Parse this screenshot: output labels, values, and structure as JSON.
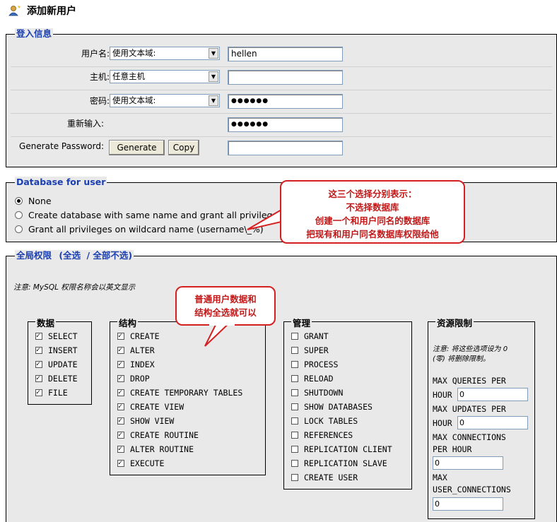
{
  "page": {
    "title": "添加新用户"
  },
  "login": {
    "legend": "登入信息",
    "username": {
      "label": "用户名:",
      "mode": "使用文本域:",
      "value": "hellen"
    },
    "host": {
      "label": "主机:",
      "mode": "任意主机",
      "value": ""
    },
    "password": {
      "label": "密码:",
      "mode": "使用文本域:",
      "value": "●●●●●●"
    },
    "retype": {
      "label": "重新输入:",
      "value": "●●●●●●"
    },
    "generate": {
      "label": "Generate Password:",
      "generate_btn": "Generate",
      "copy_btn": "Copy",
      "value": ""
    }
  },
  "database": {
    "legend": "Database for user",
    "options": [
      {
        "label": "None",
        "selected": true
      },
      {
        "label": "Create database with same name and grant all privileges",
        "selected": false
      },
      {
        "label": "Grant all privileges on wildcard name (username\\_%)",
        "selected": false
      }
    ],
    "callout": [
      "这三个选择分别表示：",
      "不选择数据库",
      "创建一个和用户同名的数据库",
      "把现有和用户同名数据库权限给他"
    ]
  },
  "global": {
    "legend": "全局权限",
    "select_all": "(全选",
    "separator": "/",
    "deselect_all": "全部不选)",
    "note": "注意: MySQL 权限名称会以英文显示",
    "callout": [
      "普通用户数据和",
      "结构全选就可以"
    ],
    "data_group": {
      "legend": "数据",
      "items": [
        {
          "label": "SELECT",
          "checked": true
        },
        {
          "label": "INSERT",
          "checked": true
        },
        {
          "label": "UPDATE",
          "checked": true
        },
        {
          "label": "DELETE",
          "checked": true
        },
        {
          "label": "FILE",
          "checked": true
        }
      ]
    },
    "structure_group": {
      "legend": "结构",
      "items": [
        {
          "label": "CREATE",
          "checked": true
        },
        {
          "label": "ALTER",
          "checked": true
        },
        {
          "label": "INDEX",
          "checked": true
        },
        {
          "label": "DROP",
          "checked": true
        },
        {
          "label": "CREATE TEMPORARY TABLES",
          "checked": true
        },
        {
          "label": "CREATE VIEW",
          "checked": true
        },
        {
          "label": "SHOW VIEW",
          "checked": true
        },
        {
          "label": "CREATE ROUTINE",
          "checked": true
        },
        {
          "label": "ALTER ROUTINE",
          "checked": true
        },
        {
          "label": "EXECUTE",
          "checked": true
        }
      ]
    },
    "admin_group": {
      "legend": "管理",
      "items": [
        {
          "label": "GRANT",
          "checked": false
        },
        {
          "label": "SUPER",
          "checked": false
        },
        {
          "label": "PROCESS",
          "checked": false
        },
        {
          "label": "RELOAD",
          "checked": false
        },
        {
          "label": "SHUTDOWN",
          "checked": false
        },
        {
          "label": "SHOW DATABASES",
          "checked": false
        },
        {
          "label": "LOCK TABLES",
          "checked": false
        },
        {
          "label": "REFERENCES",
          "checked": false
        },
        {
          "label": "REPLICATION CLIENT",
          "checked": false
        },
        {
          "label": "REPLICATION SLAVE",
          "checked": false
        },
        {
          "label": "CREATE USER",
          "checked": false
        }
      ]
    },
    "limits_group": {
      "legend": "资源限制",
      "note1": "注意: 将这些选项设为 0",
      "note2": "(零) 将删除限制。",
      "max_queries_l1": "MAX QUERIES PER",
      "max_queries_l2": "HOUR",
      "max_queries": "0",
      "max_updates_l1": "MAX UPDATES PER",
      "max_updates_l2": "HOUR",
      "max_updates": "0",
      "max_connections_l1": "MAX CONNECTIONS",
      "max_connections_l2": "PER HOUR",
      "max_connections": "0",
      "max_user_conn_l1": "MAX",
      "max_user_conn_l2": "USER_CONNECTIONS",
      "max_user_conn": "0"
    }
  },
  "colors": {
    "legend_blue": "#1c3fb0",
    "callout_red": "#c01818",
    "panel_gray": "#e9e9e9"
  },
  "icons": {
    "title": "user-add-icon",
    "dropdown": "chevron-down-icon"
  }
}
